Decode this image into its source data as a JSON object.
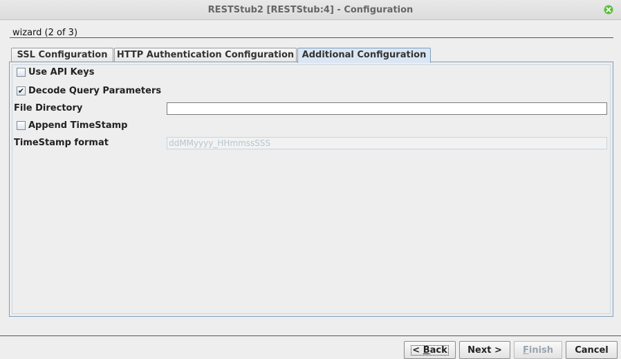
{
  "window": {
    "title": "RESTStub2 [RESTStub:4] - Configuration",
    "close_icon": "close-icon",
    "close_color": "#5bbf3b"
  },
  "wizard": {
    "step_label": "wizard (2 of 3)"
  },
  "tabs": [
    {
      "label": "SSL Configuration",
      "active": false
    },
    {
      "label": "HTTP Authentication Configuration",
      "active": false
    },
    {
      "label": "Additional Configuration",
      "active": true
    }
  ],
  "form": {
    "use_api_keys": {
      "label": "Use API Keys",
      "checked": false
    },
    "decode_query_parameters": {
      "label": "Decode Query Parameters",
      "checked": true,
      "check_glyph": "✔"
    },
    "file_directory": {
      "label": "File Directory",
      "value": ""
    },
    "append_timestamp": {
      "label": "Append TimeStamp",
      "checked": false
    },
    "timestamp_format": {
      "label": "TimeStamp format",
      "placeholder": "ddMMyyyy_HHmmssSSS",
      "enabled": false
    }
  },
  "buttons": {
    "back": {
      "prefix": "< ",
      "mnemonic": "B",
      "rest": "ack"
    },
    "next": {
      "label": "Next >"
    },
    "finish": {
      "mnemonic": "F",
      "rest": "inish",
      "enabled": false
    },
    "cancel": {
      "label": "Cancel"
    }
  }
}
